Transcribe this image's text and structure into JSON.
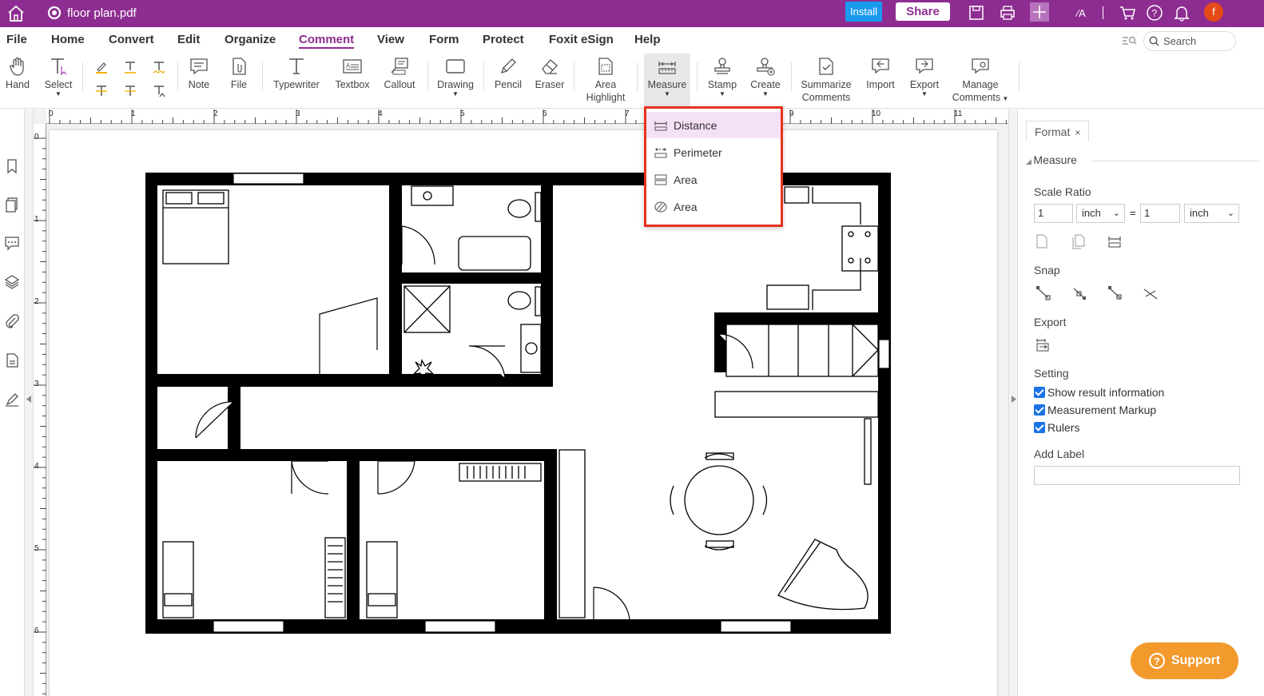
{
  "titlebar": {
    "doc_title": "floor plan.pdf",
    "install_label": "Install",
    "share_label": "Share",
    "avatar_letter": "f",
    "accent": "#8d2d91"
  },
  "menu": {
    "items": [
      "File",
      "Home",
      "Convert",
      "Edit",
      "Organize",
      "Comment",
      "View",
      "Form",
      "Protect",
      "Foxit eSign",
      "Help"
    ],
    "active": "Comment",
    "search_placeholder": "Search"
  },
  "ribbon": {
    "hand": "Hand",
    "select": "Select",
    "note": "Note",
    "file": "File",
    "typewriter": "Typewriter",
    "textbox": "Textbox",
    "callout": "Callout",
    "drawing": "Drawing",
    "pencil": "Pencil",
    "eraser": "Eraser",
    "area_highlight_1": "Area",
    "area_highlight_2": "Highlight",
    "measure": "Measure",
    "stamp": "Stamp",
    "create": "Create",
    "summarize_1": "Summarize",
    "summarize_2": "Comments",
    "import": "Import",
    "export": "Export",
    "manage_1": "Manage",
    "manage_2": "Comments"
  },
  "measure_menu": {
    "items": [
      "Distance",
      "Perimeter",
      "Area",
      "Area"
    ],
    "highlighted": "Distance"
  },
  "ruler": {
    "h_labels": [
      "0",
      "1",
      "2",
      "3",
      "4",
      "5",
      "6",
      "7",
      "8",
      "9",
      "10",
      "11"
    ],
    "v_labels": [
      "0",
      "1",
      "2",
      "3",
      "4",
      "5",
      "6"
    ]
  },
  "format_panel": {
    "tab_label": "Format",
    "tab_close": "×",
    "section": "Measure",
    "scale_ratio_label": "Scale Ratio",
    "scale_left_value": "1",
    "scale_left_unit": "inch",
    "equals": "=",
    "scale_right_value": "1",
    "scale_right_unit": "inch",
    "snap_label": "Snap",
    "export_label": "Export",
    "setting_label": "Setting",
    "show_result": "Show result information",
    "measurement_markup": "Measurement Markup",
    "rulers": "Rulers",
    "add_label": "Add Label"
  },
  "support_label": "Support"
}
